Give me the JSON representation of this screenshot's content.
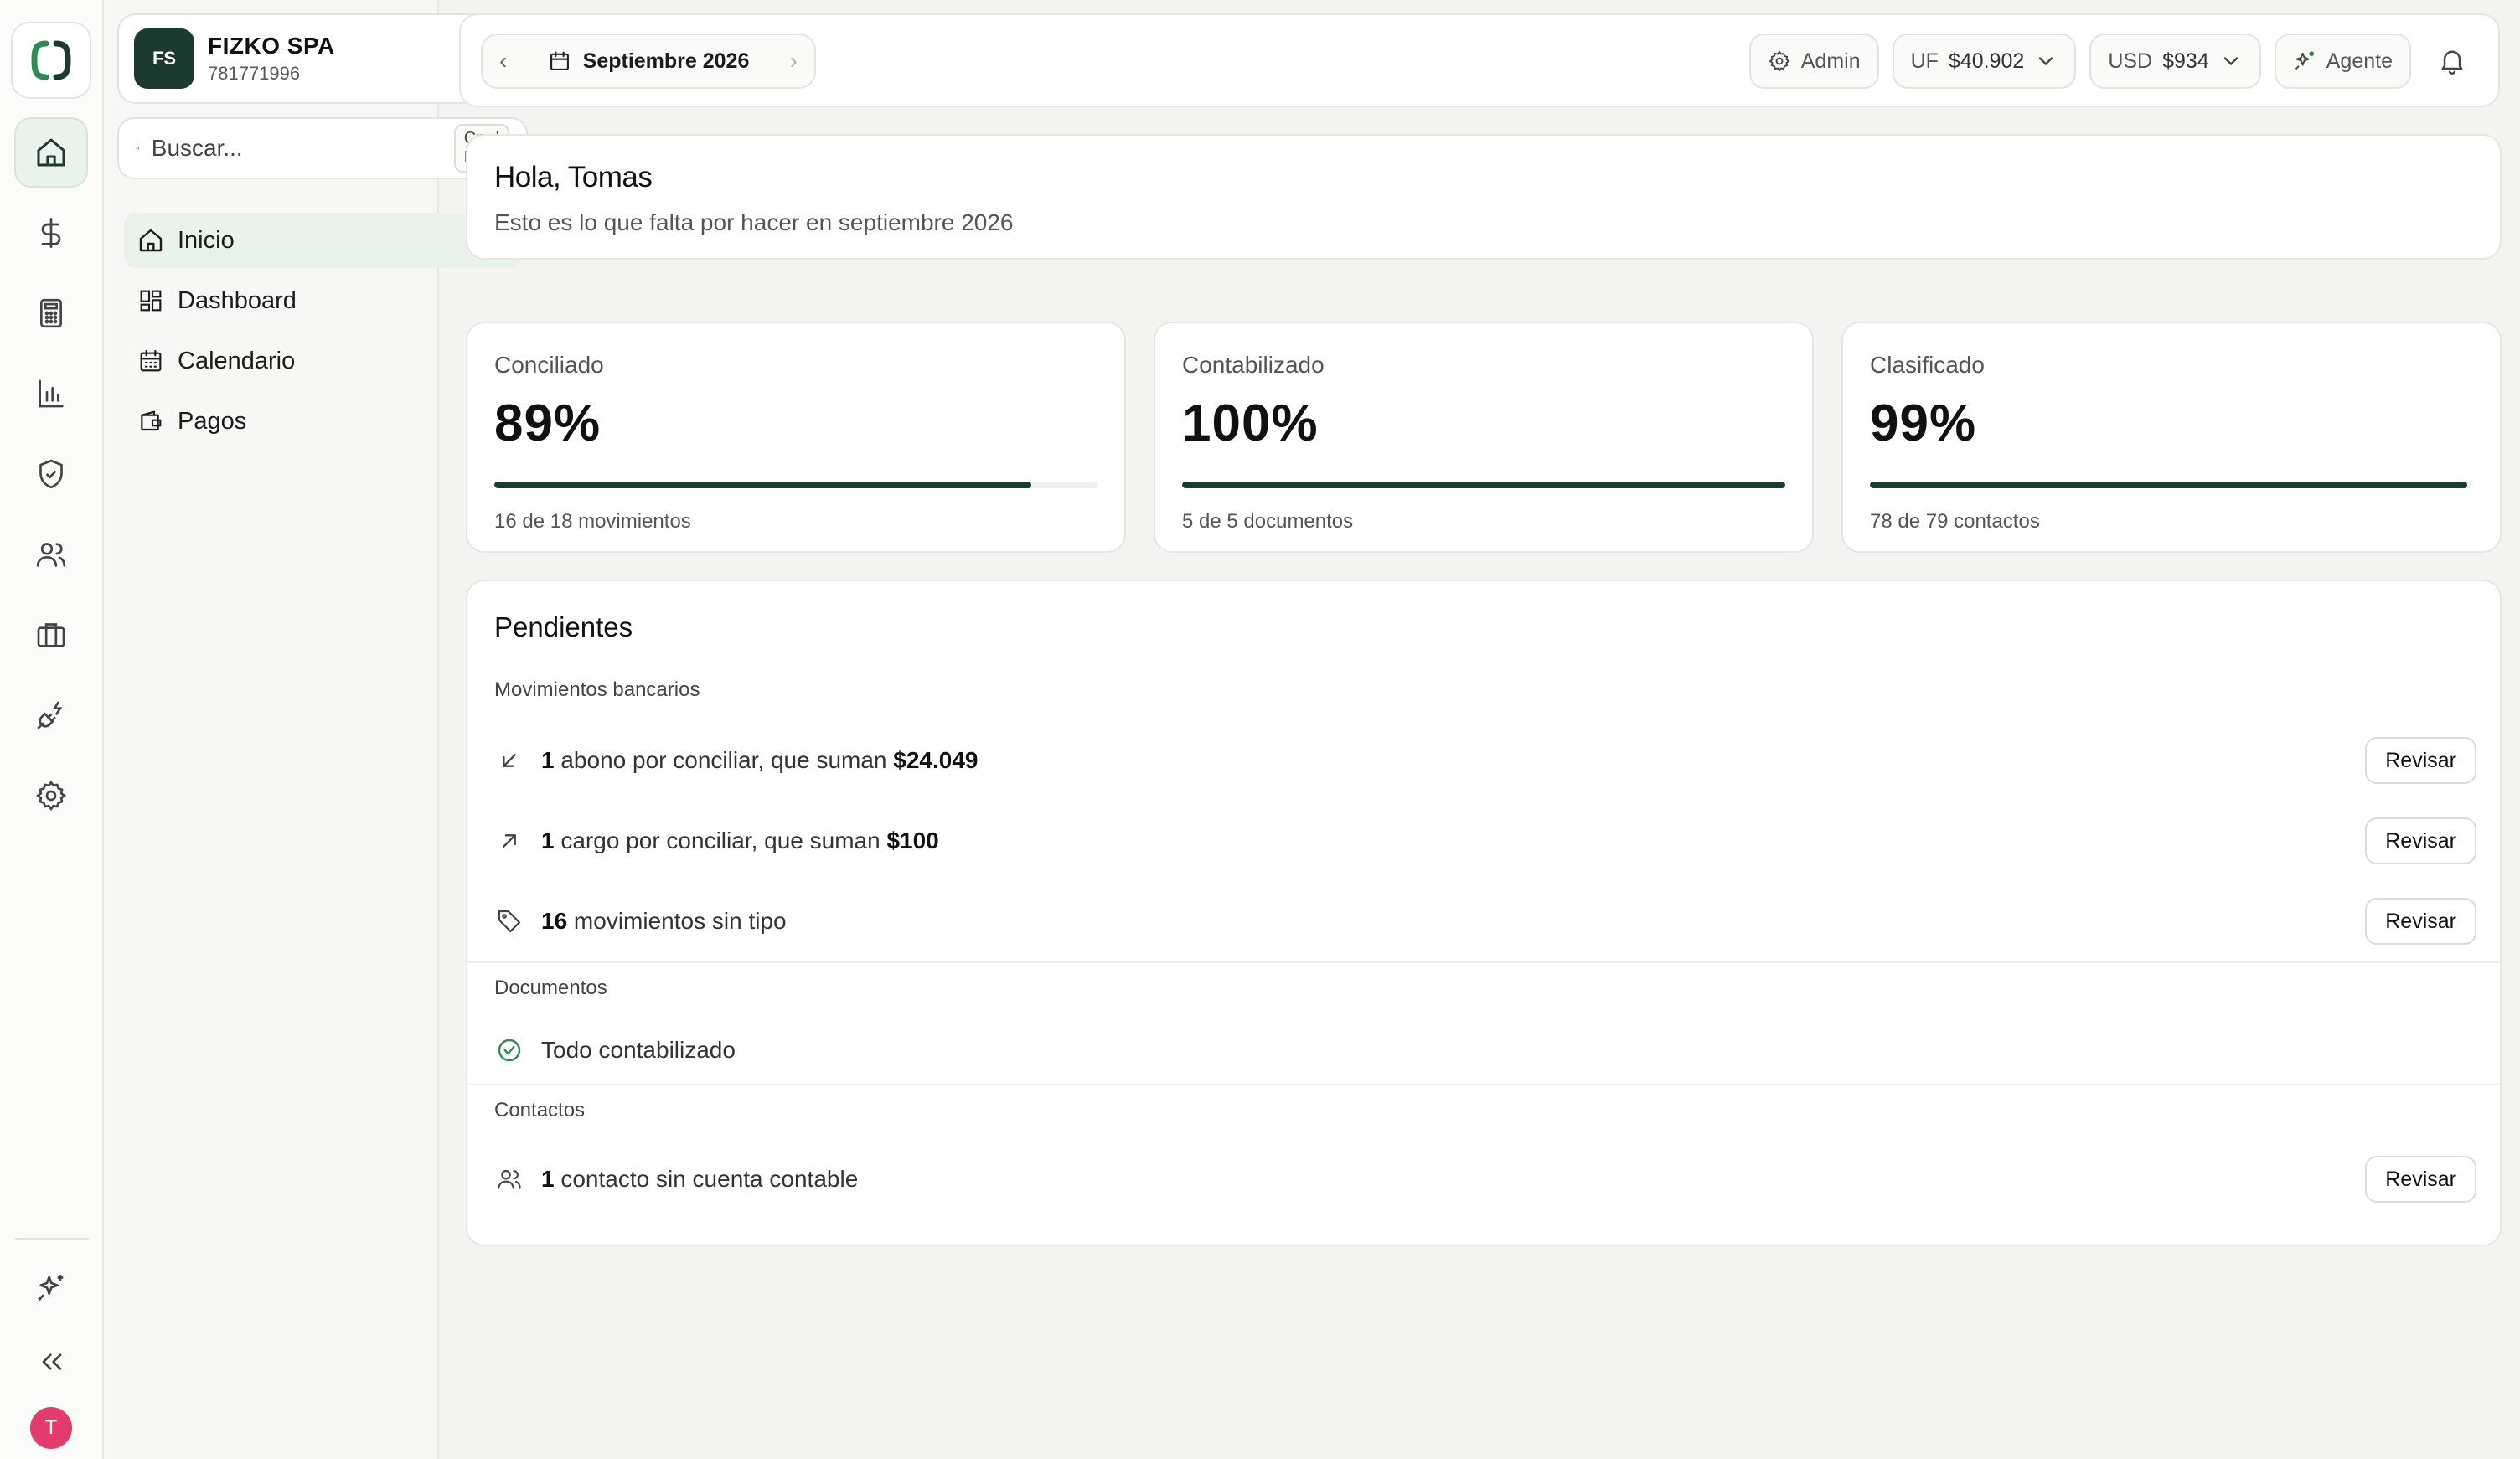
{
  "sidebar": {
    "company": {
      "badge": "FS",
      "name": "FIZKO SPA",
      "rut": "781771996"
    },
    "search": {
      "placeholder": "Buscar...",
      "shortcut": "Cmd K"
    },
    "nav": [
      {
        "label": "Inicio",
        "icon": "home-icon",
        "active": true
      },
      {
        "label": "Dashboard",
        "icon": "dashboard-icon"
      },
      {
        "label": "Calendario",
        "icon": "calendar-icon"
      },
      {
        "label": "Pagos",
        "icon": "wallet-icon"
      }
    ]
  },
  "rail": {
    "icons": [
      "home-icon",
      "dollar-icon",
      "calculator-icon",
      "bar-chart-icon",
      "shield-check-icon",
      "users-icon",
      "briefcase-icon",
      "plug-icon",
      "gear-icon"
    ],
    "bottom_icons": [
      "sparkles-icon",
      "collapse-icon"
    ],
    "avatar_initial": "T"
  },
  "topbar": {
    "month": "Septiembre 2026",
    "role": "Admin",
    "uf": {
      "label": "UF",
      "value": "$40.902"
    },
    "usd": {
      "label": "USD",
      "value": "$934"
    },
    "agent": "Agente"
  },
  "greeting": {
    "title": "Hola, Tomas",
    "subtitle": "Esto es lo que falta por hacer en septiembre 2026"
  },
  "stats": [
    {
      "label": "Conciliado",
      "value": "89%",
      "progress": 0.89,
      "footer": "16 de 18 movimientos"
    },
    {
      "label": "Contabilizado",
      "value": "100%",
      "progress": 1.0,
      "footer": "5 de 5 documentos"
    },
    {
      "label": "Clasificado",
      "value": "99%",
      "progress": 0.99,
      "footer": "78 de 79 contactos"
    }
  ],
  "pendientes": {
    "title": "Pendientes",
    "review_label": "Revisar",
    "bancarios": {
      "label": "Movimientos bancarios",
      "rows": [
        {
          "count": "1",
          "text": " abono por conciliar, que suman ",
          "amount": "$24.049"
        },
        {
          "count": "1",
          "text": " cargo por conciliar, que suman ",
          "amount": "$100"
        },
        {
          "count": "16",
          "text": " movimientos sin tipo",
          "amount": ""
        }
      ]
    },
    "documentos": {
      "label": "Documentos",
      "status": "Todo contabilizado"
    },
    "contactos": {
      "label": "Contactos",
      "rows": [
        {
          "count": "1",
          "text": " contacto sin cuenta contable"
        }
      ]
    }
  },
  "colors": {
    "accent": "#1d3a31",
    "active_bg": "#e9f3ec",
    "success": "#2e8b57",
    "avatar": "#e23b6d"
  }
}
